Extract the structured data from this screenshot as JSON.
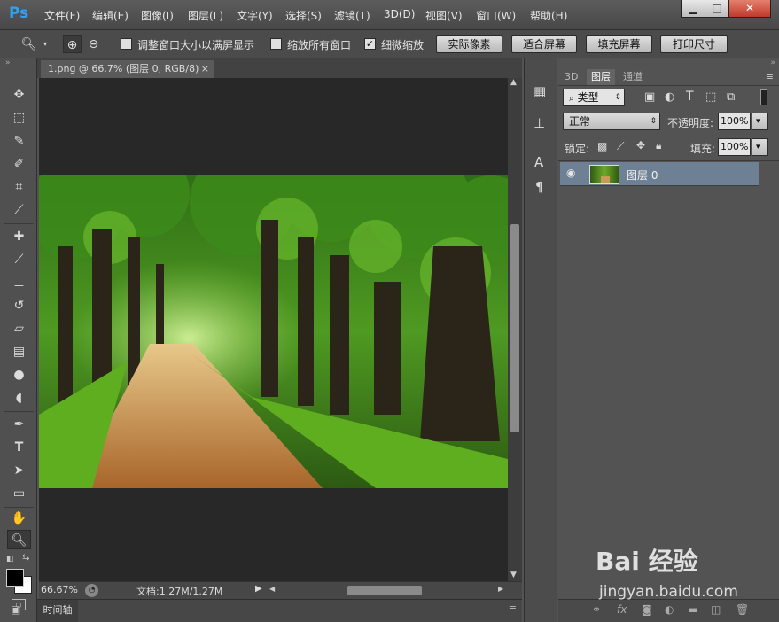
{
  "app": {
    "logo": "Ps"
  },
  "menu": [
    "文件(F)",
    "编辑(E)",
    "图像(I)",
    "图层(L)",
    "文字(Y)",
    "选择(S)",
    "滤镜(T)",
    "3D(D)",
    "视图(V)",
    "窗口(W)",
    "帮助(H)"
  ],
  "window_controls": {
    "minimize": "▁",
    "maximize": "□",
    "close": "✕"
  },
  "options": {
    "resize_windows_label": "调整窗口大小以满屏显示",
    "resize_windows_checked": false,
    "zoom_all_label": "缩放所有窗口",
    "zoom_all_checked": false,
    "scrubby_zoom_label": "细微缩放",
    "scrubby_zoom_checked": true,
    "buttons": [
      "实际像素",
      "适合屏幕",
      "填充屏幕",
      "打印尺寸"
    ]
  },
  "document": {
    "tab_title": "1.png @ 66.7% (图层 0, RGB/8)",
    "tab_close": "×",
    "zoom": "66.67%",
    "doc_info": "文档:1.27M/1.27M"
  },
  "timeline": {
    "label": "时间轴"
  },
  "panel": {
    "tabs": [
      "3D",
      "图层",
      "通道"
    ],
    "active_tab": "图层",
    "filter_kind": "类型",
    "blend_mode": "正常",
    "opacity_label": "不透明度:",
    "opacity_value": "100%",
    "lock_label": "锁定:",
    "fill_label": "填充:",
    "fill_value": "100%",
    "layers": [
      {
        "name": "图层 0",
        "visible": true
      }
    ]
  },
  "watermark": {
    "brand": "Bai 经验",
    "url": "jingyan.baidu.com"
  },
  "colors": {
    "accent": "#2fa3f3",
    "selected_layer": "#6d8094",
    "canvas_bg": "#282828",
    "panel_bg": "#535353"
  }
}
